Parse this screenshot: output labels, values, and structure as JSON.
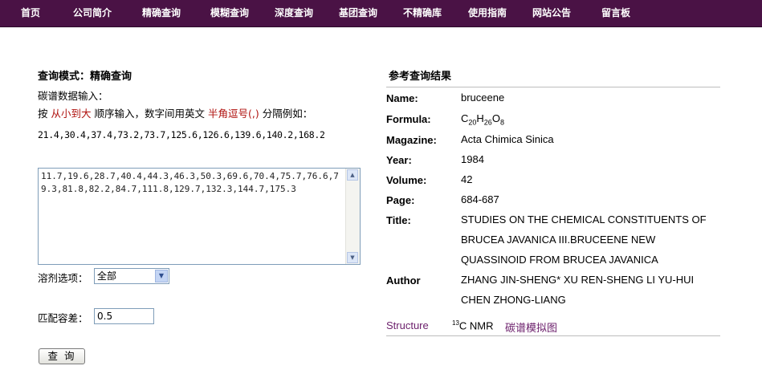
{
  "nav": {
    "items": [
      "首页",
      "公司简介",
      "精确查询",
      "模糊查询",
      "深度查询",
      "基团查询",
      "不精确库",
      "使用指南",
      "网站公告",
      "留言板"
    ]
  },
  "query": {
    "mode_label": "查询模式：精确查询",
    "input_label": "碳谱数据输入：",
    "instr_prefix": "按",
    "instr_order": "从小到大",
    "instr_middle": "顺序输入，数字间用英文",
    "instr_sep": "半角逗号(,)",
    "instr_suffix": "分隔例如：",
    "example": "21.4,30.4,37.4,73.2,73.7,125.6,126.6,139.6,140.2,168.2",
    "shifts": "11.7,19.6,28.7,40.4,44.3,46.3,50.3,69.6,70.4,75.7,76.6,79.3,81.8,82.2,84.7,111.8,129.7,132.3,144.7,175.3",
    "solvent_label": "溶剂选项：",
    "solvent_value": "全部",
    "tolerance_label": "匹配容差：",
    "tolerance_value": "0.5",
    "submit_label": "查 询"
  },
  "result": {
    "title": "参考查询结果",
    "name_label": "Name:",
    "name": "bruceene",
    "formula_label": "Formula:",
    "formula": {
      "c": "C",
      "c_n": "20",
      "h": "H",
      "h_n": "26",
      "o": "O",
      "o_n": "8"
    },
    "magazine_label": "Magazine:",
    "magazine": "Acta Chimica Sinica",
    "year_label": "Year:",
    "year": "1984",
    "volume_label": "Volume:",
    "volume": "42",
    "page_label": "Page:",
    "page": "684-687",
    "title_label": "Title:",
    "title_lines": [
      "STUDIES ON THE CHEMICAL CONSTITUENTS OF",
      "BRUCEA JAVANICA III.BRUCEENE NEW",
      "QUASSINOID FROM BRUCEA JAVANICA"
    ],
    "author_label": "Author",
    "author_lines": [
      "ZHANG JIN-SHENG* XU REN-SHENG LI YU-HUI",
      "CHEN ZHONG-LIANG"
    ],
    "links": {
      "structure": "Structure",
      "nmr_sup": "13",
      "nmr": "C NMR",
      "sim": "碳谱模拟图"
    }
  }
}
